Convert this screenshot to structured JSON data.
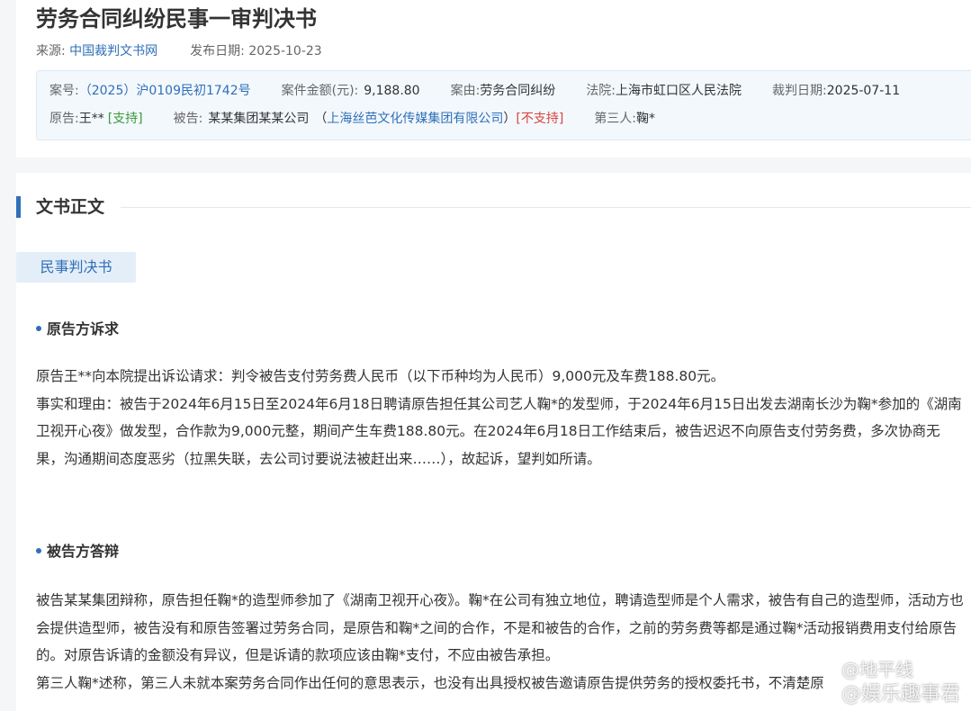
{
  "header": {
    "title": "劳务合同纠纷民事一审判决书",
    "source_label": "来源:",
    "source_value": "中国裁判文书网",
    "date_label": "发布日期:",
    "date_value": "2025-10-23"
  },
  "info": {
    "case_no_label": "案号:",
    "case_no": "（2025）沪0109民初1742号",
    "amount_label": "案件金额(元):",
    "amount": "9,188.80",
    "cause_label": "案由:",
    "cause": "劳务合同纠纷",
    "court_label": "法院:",
    "court": "上海市虹口区人民法院",
    "judge_date_label": "裁判日期:",
    "judge_date": "2025-07-11",
    "plaintiff_label": "原告:",
    "plaintiff": "王**",
    "plaintiff_status": "[支持]",
    "defendant_label": "被告:",
    "defendant": "某某集团某某公司",
    "defendant_open": "（",
    "defendant_alias": "上海丝芭文化传媒集团有限公司",
    "defendant_close": "）",
    "defendant_status": "[不支持]",
    "third_label": "第三人:",
    "third": "鞠*"
  },
  "body": {
    "section_title": "文书正文",
    "doc_type_tab": "民事判决书",
    "plaintiff_claim_heading": "原告方诉求",
    "plaintiff_claim_paragraphs": [
      "原告王**向本院提出诉讼请求：判令被告支付劳务费人民币（以下币种均为人民币）9,000元及车费188.80元。",
      "事实和理由：被告于2024年6月15日至2024年6月18日聘请原告担任其公司艺人鞠*的发型师，于2024年6月15日出发去湖南长沙为鞠*参加的《湖南卫视开心夜》做发型，合作款为9,000元整，期间产生车费188.80元。在2024年6月18日工作结束后，被告迟迟不向原告支付劳务费，多次协商无果，沟通期间态度恶劣（拉黑失联，去公司讨要说法被赶出来……），故起诉，望判如所请。"
    ],
    "defense_heading": "被告方答辩",
    "defense_paragraphs": [
      "被告某某集团辩称，原告担任鞠*的造型师参加了《湖南卫视开心夜》。鞠*在公司有独立地位，聘请造型师是个人需求，被告有自己的造型师，活动方也会提供造型师，被告没有和原告签署过劳务合同，是原告和鞠*之间的合作，不是和被告的合作，之前的劳务费等都是通过鞠*活动报销费用支付给原告的。对原告诉请的金额没有异议，但是诉请的款项应该由鞠*支付，不应由被告承担。",
      "第三人鞠*述称，第三人未就本案劳务合同作出任何的意思表示，也没有出具授权被告邀请原告提供劳务的授权委托书，不清楚原"
    ]
  },
  "watermark": {
    "line1": "@娱乐趣事君",
    "line2": "@地平线"
  }
}
